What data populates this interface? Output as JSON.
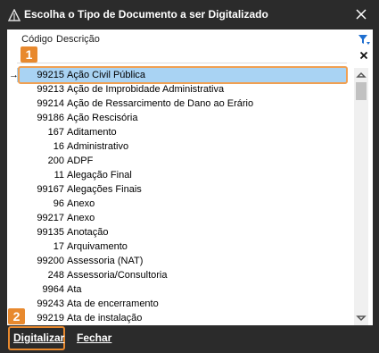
{
  "window": {
    "title": "Escolha o Tipo de Documento a ser Digitalizado"
  },
  "table": {
    "columns": {
      "code": "Código",
      "description": "Descrição"
    },
    "rows": [
      {
        "code": "99215",
        "description": "Ação Civil Pública",
        "selected": true
      },
      {
        "code": "99213",
        "description": "Ação de Improbidade Administrativa"
      },
      {
        "code": "99214",
        "description": "Ação de Ressarcimento de Dano ao Erário"
      },
      {
        "code": "99186",
        "description": "Ação Rescisória"
      },
      {
        "code": "167",
        "description": "Aditamento"
      },
      {
        "code": "16",
        "description": "Administrativo"
      },
      {
        "code": "200",
        "description": "ADPF"
      },
      {
        "code": "11",
        "description": "Alegação Final"
      },
      {
        "code": "99167",
        "description": "Alegações Finais"
      },
      {
        "code": "96",
        "description": "Anexo"
      },
      {
        "code": "99217",
        "description": "Anexo"
      },
      {
        "code": "99135",
        "description": "Anotação"
      },
      {
        "code": "17",
        "description": "Arquivamento"
      },
      {
        "code": "99200",
        "description": "Assessoria (NAT)"
      },
      {
        "code": "248",
        "description": "Assessoria/Consultoria"
      },
      {
        "code": "9964",
        "description": "Ata"
      },
      {
        "code": "99243",
        "description": "Ata de encerramento"
      },
      {
        "code": "99219",
        "description": "Ata de instalação"
      }
    ]
  },
  "callouts": {
    "one": "1",
    "two": "2"
  },
  "footer": {
    "digitalizar": "Digitalizar",
    "fechar": "Fechar"
  },
  "colors": {
    "accent": "#e8892e",
    "selection": "#a9d3f3",
    "chrome": "#2b2b2b"
  }
}
